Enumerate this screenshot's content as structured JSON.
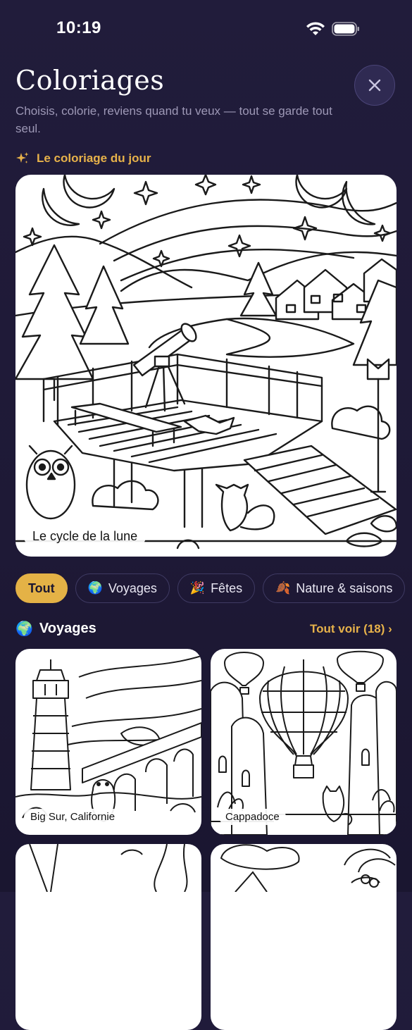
{
  "status_bar": {
    "time": "10:19"
  },
  "header": {
    "title": "Coloriages",
    "subtitle": "Choisis, colorie, reviens quand tu veux — tout se garde tout seul."
  },
  "daily": {
    "icon": "sparkles-icon",
    "label": "Le coloriage du jour",
    "card_title": "Le cycle de la lune"
  },
  "chips": [
    {
      "emoji": "",
      "label": "Tout",
      "active": true
    },
    {
      "emoji": "🌍",
      "label": "Voyages",
      "active": false
    },
    {
      "emoji": "🎉",
      "label": "Fêtes",
      "active": false
    },
    {
      "emoji": "🍂",
      "label": "Nature & saisons",
      "active": false
    }
  ],
  "section": {
    "emoji": "🌍",
    "title": "Voyages",
    "see_all": "Tout voir (18) ›"
  },
  "cards": [
    {
      "label": "Big Sur, Californie"
    },
    {
      "label": "Cappadoce"
    },
    {
      "label": ""
    },
    {
      "label": ""
    }
  ],
  "colors": {
    "accent": "#e4b246",
    "background": "#1f1a38"
  }
}
